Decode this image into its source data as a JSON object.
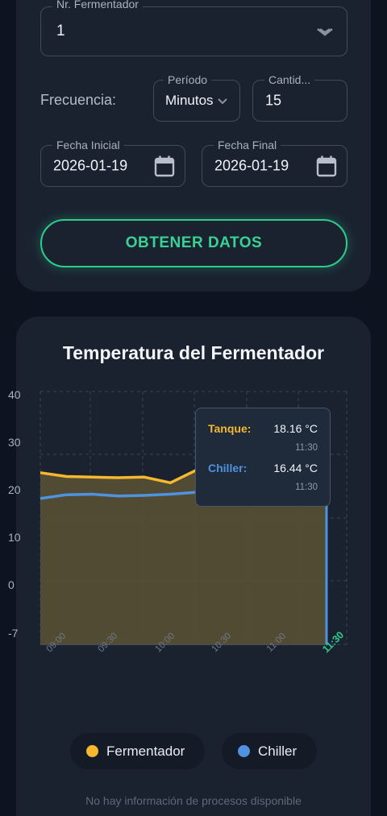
{
  "form": {
    "fermentador": {
      "label": "Nr. Fermentador",
      "value": "1"
    },
    "frecuencia_label": "Frecuencia:",
    "periodo": {
      "label": "Período",
      "value": "Minutos"
    },
    "cantidad": {
      "label": "Cantid...",
      "value": "15"
    },
    "fecha_inicial": {
      "label": "Fecha Inicial",
      "value": "2026-01-19"
    },
    "fecha_final": {
      "label": "Fecha Final",
      "value": "2026-01-19"
    },
    "submit_label": "OBTENER DATOS"
  },
  "colors": {
    "tanque": "#f5b82e",
    "chiller": "#4f92e0",
    "accent": "#2ecc8a",
    "area": "#5a5232"
  },
  "chart_data": {
    "type": "line",
    "title": "Temperatura del Fermentador",
    "y_ticks": [
      "40",
      "30",
      "20",
      "10",
      "0",
      "-7"
    ],
    "x_ticks": [
      "09:00",
      "09:30",
      "10:00",
      "10:30",
      "11:00",
      "11:30"
    ],
    "grid": true,
    "legend": "bottom",
    "series": [
      {
        "name": "Fermentador",
        "x": [
          "08:45",
          "09:00",
          "09:15",
          "09:30",
          "09:45",
          "10:00",
          "10:15",
          "10:30",
          "10:45",
          "11:00",
          "11:15",
          "11:30"
        ],
        "values": [
          17.1,
          16.5,
          16.4,
          16.3,
          16.4,
          15.5,
          17.5,
          17.6,
          17.7,
          17.8,
          18.0,
          18.16
        ]
      },
      {
        "name": "Chiller",
        "x": [
          "08:45",
          "09:00",
          "09:15",
          "09:30",
          "09:45",
          "10:00",
          "10:15",
          "10:30",
          "10:45",
          "11:00",
          "11:15",
          "11:30"
        ],
        "values": [
          13.0,
          13.6,
          13.7,
          13.4,
          13.5,
          13.7,
          14.0,
          14.3,
          14.6,
          14.9,
          15.3,
          16.44
        ]
      }
    ]
  },
  "tooltip": {
    "tanque_label": "Tanque:",
    "tanque_value": "18.16 °C",
    "tanque_time": "11:30",
    "chiller_label": "Chiller:",
    "chiller_value": "16.44 °C",
    "chiller_time": "11:30"
  },
  "legend": {
    "items": [
      {
        "name": "Fermentador",
        "color": "#f5b82e"
      },
      {
        "name": "Chiller",
        "color": "#4f92e0"
      }
    ]
  },
  "footer_note": "No hay información de procesos disponible"
}
